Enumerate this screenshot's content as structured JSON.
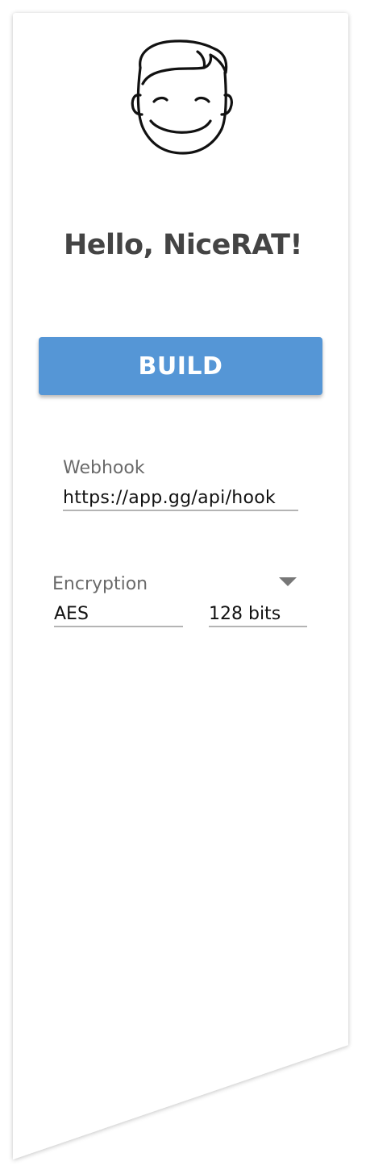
{
  "greeting": "Hello, NiceRAT!",
  "build_button": {
    "label": "BUILD",
    "color": "#5596d6"
  },
  "webhook": {
    "label": "Webhook",
    "value": "https://app.gg/api/hook"
  },
  "encryption": {
    "label": "Encryption",
    "algorithm": "AES",
    "key_size": "128 bits",
    "dropdown_icon": "caret-down-icon"
  },
  "avatar_icon": "smiling-face-icon"
}
